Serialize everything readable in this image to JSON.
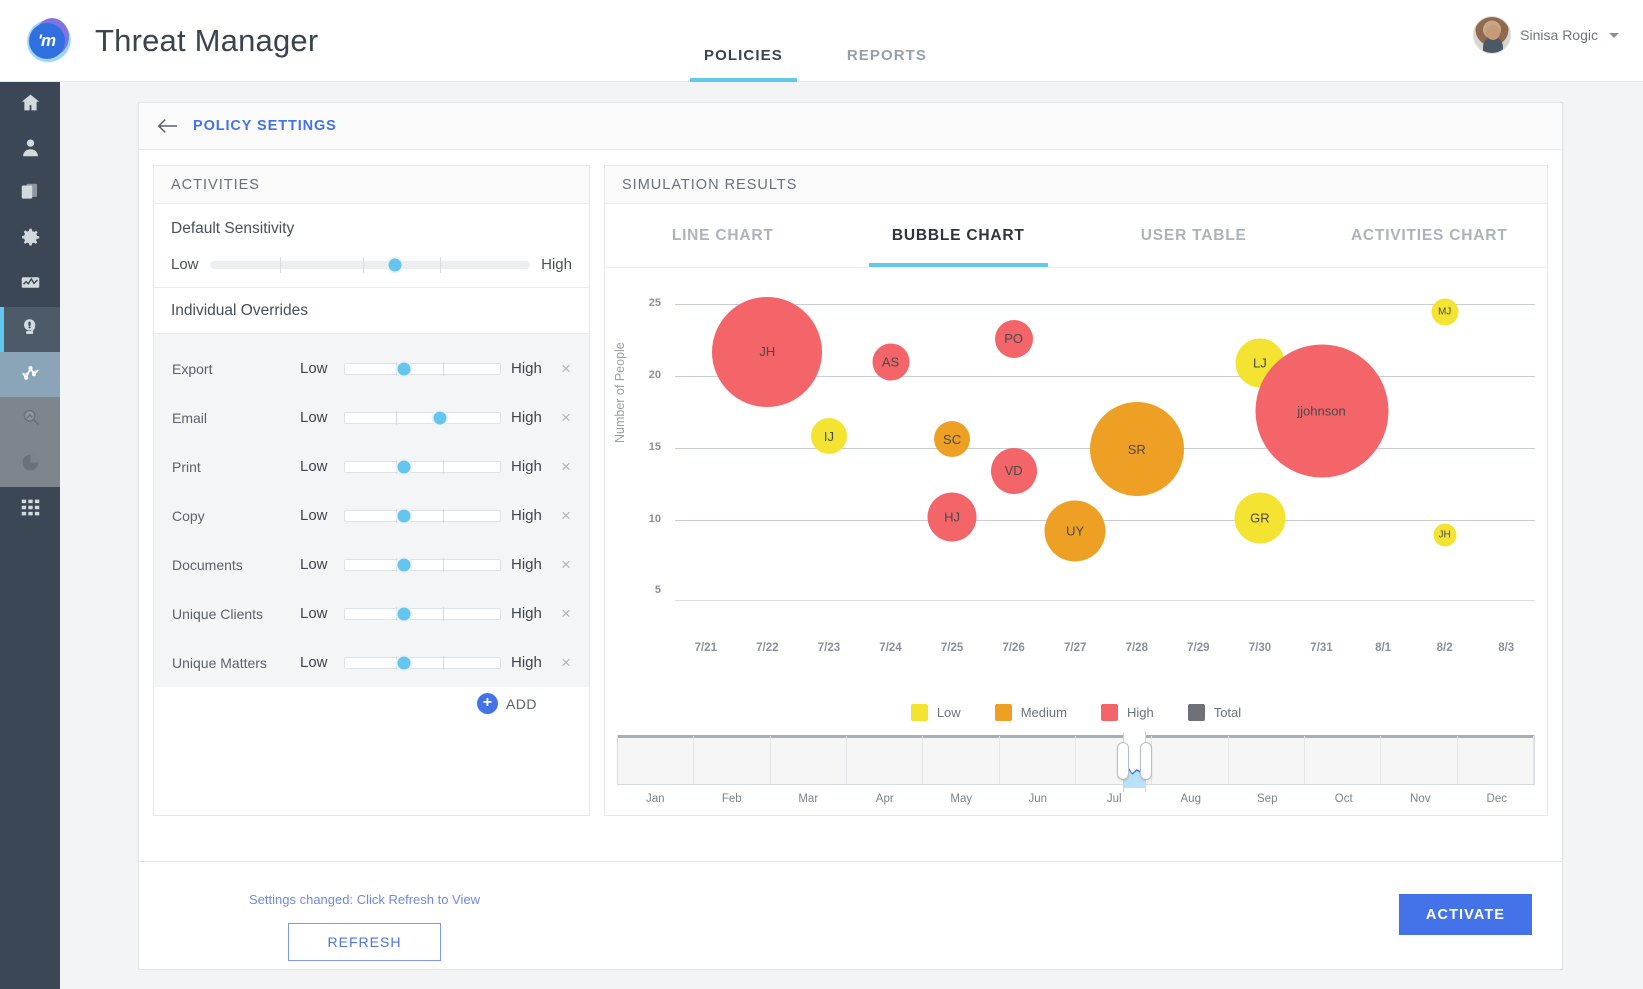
{
  "app": {
    "logo_text": "'m",
    "title": "Threat Manager"
  },
  "nav": {
    "tabs": [
      {
        "label": "POLICIES",
        "active": true
      },
      {
        "label": "REPORTS",
        "active": false
      }
    ]
  },
  "user": {
    "name": "Sinisa Rogic"
  },
  "rail": {
    "items": [
      {
        "name": "home-icon"
      },
      {
        "name": "user-icon"
      },
      {
        "name": "copy-documents-icon"
      },
      {
        "name": "gear-icon"
      },
      {
        "name": "dashboard-icon"
      },
      {
        "name": "threat-alert-icon"
      },
      {
        "name": "analytics-line-icon"
      },
      {
        "name": "magnifier-icon"
      },
      {
        "name": "pie-chart-icon"
      },
      {
        "name": "grid-icon"
      }
    ]
  },
  "card": {
    "back_label": "POLICY SETTINGS"
  },
  "activities": {
    "title": "ACTIVITIES",
    "default_sensitivity_label": "Default Sensitivity",
    "low_label": "Low",
    "high_label": "High",
    "default_sensitivity_value": 58,
    "individual_overrides_label": "Individual Overrides",
    "overrides": [
      {
        "name": "Export",
        "low": "Low",
        "high": "High",
        "value": 38
      },
      {
        "name": "Email",
        "low": "Low",
        "high": "High",
        "value": 61
      },
      {
        "name": "Print",
        "low": "Low",
        "high": "High",
        "value": 38
      },
      {
        "name": "Copy",
        "low": "Low",
        "high": "High",
        "value": 38
      },
      {
        "name": "Documents",
        "low": "Low",
        "high": "High",
        "value": 38
      },
      {
        "name": "Unique Clients",
        "low": "Low",
        "high": "High",
        "value": 38
      },
      {
        "name": "Unique Matters",
        "low": "Low",
        "high": "High",
        "value": 38
      }
    ],
    "add_label": "ADD",
    "settings_note": "Settings changed: Click Refresh to View",
    "refresh_label": "REFRESH"
  },
  "simulation": {
    "title": "SIMULATION RESULTS",
    "tabs": [
      {
        "label": "LINE CHART",
        "active": false
      },
      {
        "label": "BUBBLE CHART",
        "active": true
      },
      {
        "label": "USER TABLE",
        "active": false
      },
      {
        "label": "ACTIVITIES CHART",
        "active": false
      }
    ]
  },
  "chart_data": {
    "type": "scatter",
    "title": "",
    "xlabel": "",
    "ylabel": "Number of People",
    "ylim": [
      3,
      26
    ],
    "yticks": [
      25,
      20,
      15,
      10,
      5
    ],
    "grid": true,
    "xticks": [
      "7/21",
      "7/22",
      "7/23",
      "7/24",
      "7/25",
      "7/26",
      "7/27",
      "7/28",
      "7/29",
      "7/30",
      "7/31",
      "8/1",
      "8/2",
      "8/3"
    ],
    "legend_position": "bottom",
    "legend": [
      {
        "label": "Low",
        "color": "#f5e331"
      },
      {
        "label": "Medium",
        "color": "#eda024"
      },
      {
        "label": "High",
        "color": "#f4656a"
      },
      {
        "label": "Total",
        "color": "#6e7278"
      }
    ],
    "points": [
      {
        "label": "JH",
        "x": "7/22",
        "y": 21.7,
        "size": 110,
        "risk": "High",
        "color": "#f4656a"
      },
      {
        "label": "AS",
        "x": "7/24",
        "y": 21.0,
        "size": 37,
        "risk": "High",
        "color": "#f4656a"
      },
      {
        "label": "PO",
        "x": "7/26",
        "y": 22.6,
        "size": 38,
        "risk": "High",
        "color": "#f4656a"
      },
      {
        "label": "MJ",
        "x": "8/2",
        "y": 24.5,
        "size": 27,
        "risk": "Low",
        "color": "#f5e331"
      },
      {
        "label": "LJ",
        "x": "7/30",
        "y": 20.9,
        "size": 49,
        "risk": "Low",
        "color": "#f5e331"
      },
      {
        "label": "jjohnson",
        "x": "7/31",
        "y": 17.6,
        "size": 133,
        "risk": "High",
        "color": "#f4656a"
      },
      {
        "label": "IJ",
        "x": "7/23",
        "y": 15.8,
        "size": 36,
        "risk": "Low",
        "color": "#f5e331"
      },
      {
        "label": "SC",
        "x": "7/25",
        "y": 15.6,
        "size": 36,
        "risk": "Medium",
        "color": "#eda024"
      },
      {
        "label": "SR",
        "x": "7/28",
        "y": 14.9,
        "size": 94,
        "risk": "Medium",
        "color": "#eda024"
      },
      {
        "label": "VD",
        "x": "7/26",
        "y": 13.4,
        "size": 46,
        "risk": "High",
        "color": "#f4656a"
      },
      {
        "label": "HJ",
        "x": "7/25",
        "y": 10.2,
        "size": 49,
        "risk": "High",
        "color": "#f4656a"
      },
      {
        "label": "UY",
        "x": "7/27",
        "y": 9.2,
        "size": 61,
        "risk": "Medium",
        "color": "#eda024"
      },
      {
        "label": "GR",
        "x": "7/30",
        "y": 10.1,
        "size": 51,
        "risk": "Low",
        "color": "#f5e331"
      },
      {
        "label": "JH",
        "x": "8/2",
        "y": 8.9,
        "size": 23,
        "risk": "Low",
        "color": "#f5e331"
      }
    ]
  },
  "range_slider": {
    "months": [
      "Jan",
      "Feb",
      "Mar",
      "Apr",
      "May",
      "Jun",
      "Jul",
      "Aug",
      "Sep",
      "Oct",
      "Nov",
      "Dec"
    ],
    "selection_start": "Jul",
    "selection_end": "Aug"
  },
  "footer": {
    "activate_label": "ACTIVATE"
  },
  "colors": {
    "accent_blue": "#4472e8",
    "tab_underline": "#63c8f0",
    "rail_bg": "#3b4755",
    "low": "#f5e331",
    "medium": "#eda024",
    "high": "#f4656a",
    "total": "#6e7278"
  }
}
